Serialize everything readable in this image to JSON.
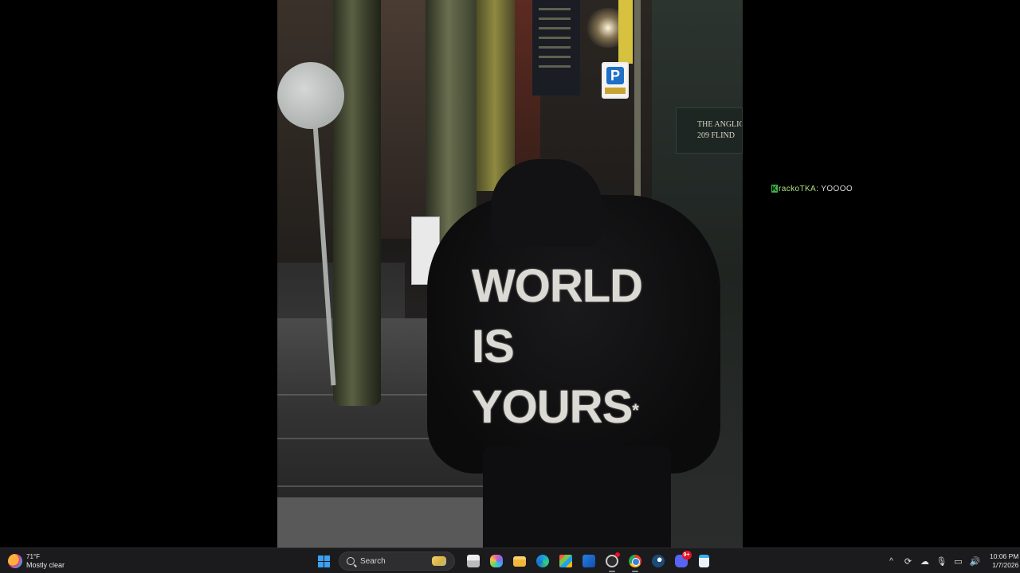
{
  "photo": {
    "wall_sign_line1": "THE ANGLIC",
    "wall_sign_line2": "209 FLIND",
    "parking_letter": "P",
    "jacket_print": [
      "WORLD",
      "IS",
      "YOURS"
    ],
    "jacket_asterisk": "*"
  },
  "chat": {
    "badge": "K",
    "username": "rackoTKA",
    "message": "YOOOO"
  },
  "taskbar": {
    "weather": {
      "temp": "71°F",
      "condition": "Mostly clear"
    },
    "search_label": "Search",
    "apps": [
      {
        "name": "file-manager",
        "icon": "files-icon"
      },
      {
        "name": "copilot",
        "icon": "copilot-icon"
      },
      {
        "name": "file-explorer",
        "icon": "folder-icon"
      },
      {
        "name": "edge",
        "icon": "edge-icon"
      },
      {
        "name": "store",
        "icon": "store-icon"
      },
      {
        "name": "outlook",
        "icon": "mail-icon"
      },
      {
        "name": "clock",
        "icon": "clock-icon"
      },
      {
        "name": "chrome",
        "icon": "chrome-icon"
      },
      {
        "name": "steam",
        "icon": "steam-icon"
      },
      {
        "name": "discord",
        "icon": "discord-icon",
        "badge": "9+"
      },
      {
        "name": "notepad",
        "icon": "notepad-icon"
      }
    ],
    "time": "10:06 PM",
    "date": "1/7/2026"
  }
}
